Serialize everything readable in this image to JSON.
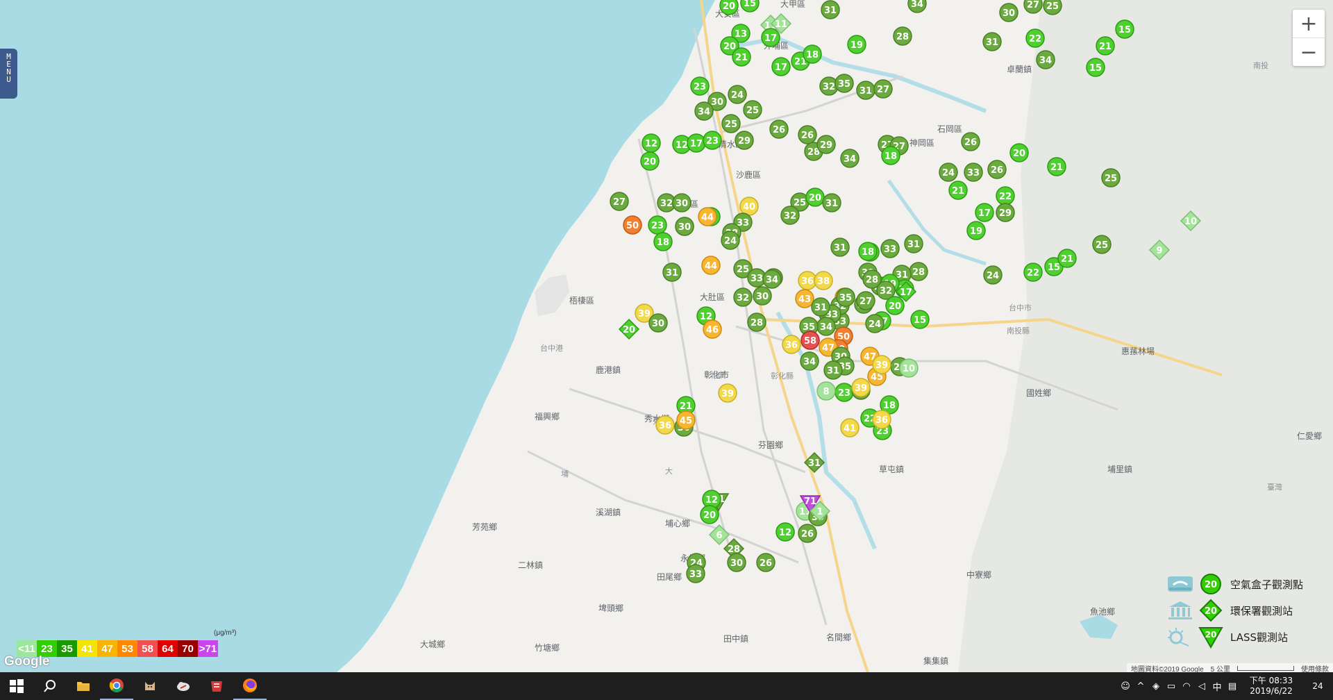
{
  "menu_tab": {
    "label": "MENU"
  },
  "zoom": {
    "in_label": "+",
    "out_label": "−"
  },
  "place_names": [
    "大甲區",
    "大安區",
    "外埔區",
    "卓蘭鎮",
    "石岡區",
    "神岡區",
    "清水區",
    "沙鹿區",
    "龍井區",
    "梧棲區",
    "大肚區",
    "鹿港鎮",
    "福興鄉",
    "秀水鄉",
    "彰化市",
    "芬園鄉",
    "國姓鄉",
    "草屯鎮",
    "埔里鎮",
    "溪湖鎮",
    "埔心鄉",
    "芳苑鄉",
    "二林鎮",
    "田尾鄉",
    "永靖鄉",
    "埤頭鄉",
    "竹塘鄉",
    "大城鄉",
    "田中鎮",
    "名間鄉",
    "中寮鄉",
    "魚池鄉",
    "集集鎮",
    "仁愛鄉",
    "惠蓀林場",
    "台中市",
    "南投縣",
    "彰化縣",
    "北市",
    "埔",
    "大",
    "台中港",
    "臺灣",
    "南投",
    "秀",
    "壩"
  ],
  "sensor_values": [
    20,
    15,
    31,
    30,
    27,
    25,
    34,
    11,
    11,
    17,
    13,
    20,
    21,
    17,
    21,
    18,
    19,
    28,
    31,
    22,
    21,
    15,
    15,
    34,
    23,
    24,
    30,
    25,
    26,
    32,
    35,
    31,
    27,
    34,
    25,
    12,
    20,
    12,
    17,
    23,
    29,
    26,
    28,
    29,
    34,
    27,
    27,
    18,
    26,
    20,
    21,
    24,
    33,
    26,
    21,
    22,
    17,
    29,
    19,
    25,
    24,
    22,
    15,
    21,
    10,
    9,
    25,
    27,
    32,
    30,
    20,
    40,
    33,
    25,
    20,
    31,
    30,
    32,
    50,
    23,
    30,
    18,
    28,
    24,
    31,
    25,
    34,
    18,
    33,
    28,
    31,
    19,
    31,
    18,
    28,
    33,
    34,
    36,
    38,
    45,
    32,
    29,
    12,
    28,
    45,
    35,
    30,
    33,
    32,
    20,
    39,
    30,
    30,
    43,
    36,
    35,
    19,
    33,
    27,
    31,
    28,
    32,
    17,
    50,
    34,
    50,
    46,
    44,
    44,
    39,
    36,
    21,
    30,
    45,
    24,
    47,
    47,
    31,
    35,
    58,
    34,
    30,
    35,
    31,
    23,
    22,
    33,
    45,
    28,
    39,
    18,
    23,
    36,
    10,
    15,
    17,
    20,
    8,
    39,
    41,
    31,
    11,
    26,
    71,
    12,
    35,
    31,
    12,
    20,
    6,
    1,
    28,
    30,
    26,
    24,
    33
  ],
  "concentration_scale": {
    "unit": "(μg/m³)",
    "segments": [
      {
        "label": "<11",
        "color": "#9be79b"
      },
      {
        "label": "23",
        "color": "#31cf00"
      },
      {
        "label": "35",
        "color": "#1a9900"
      },
      {
        "label": "41",
        "color": "#f2e600"
      },
      {
        "label": "47",
        "color": "#f8b400"
      },
      {
        "label": "53",
        "color": "#ff8800"
      },
      {
        "label": "58",
        "color": "#f05050"
      },
      {
        "label": "64",
        "color": "#e00000"
      },
      {
        "label": "70",
        "color": "#990000"
      },
      {
        "label": ">71",
        "color": "#cc44ee"
      }
    ]
  },
  "legend": {
    "airbox_label": "空氣盒子觀測點",
    "epa_label": "環保署觀測站",
    "lass_label": "LASS觀測站",
    "sample_value": "20"
  },
  "google_logo": "Google",
  "attribution": {
    "map_data": "地圖資料©2019 Google",
    "scale": "5 公里",
    "terms": "使用條款"
  },
  "taskbar": {
    "time": "下午 08:33",
    "date": "2019/6/22",
    "ime": "中",
    "notification_count": "24"
  }
}
